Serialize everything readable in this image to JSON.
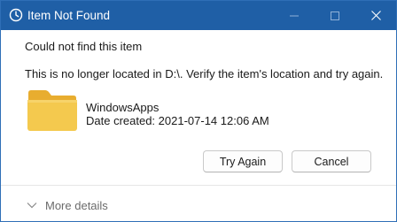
{
  "window": {
    "title": "Item Not Found",
    "title_icon": "clock-icon",
    "controls": [
      "minimize-icon",
      "maximize-icon",
      "close-icon"
    ]
  },
  "dialog": {
    "heading": "Could not find this item",
    "message": "This is no longer located in D:\\. Verify the item's location and try again.",
    "item": {
      "icon": "folder-icon",
      "name": "WindowsApps",
      "date_created": "Date created: 2021-07-14 12:06 AM"
    },
    "buttons": {
      "try_again": "Try Again",
      "cancel": "Cancel"
    }
  },
  "footer": {
    "details_label": "More details",
    "details_icon": "chevron-down-icon"
  },
  "colors": {
    "titlebar": "#1f5fa6",
    "folder": "#f4c94e",
    "folder_tab": "#e8ad2f"
  }
}
